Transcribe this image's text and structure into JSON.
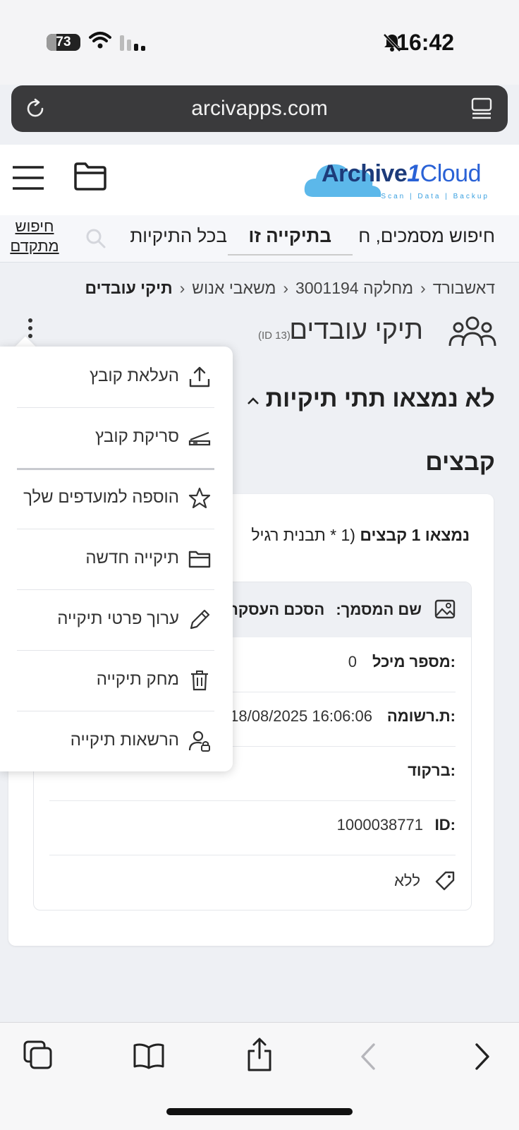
{
  "status": {
    "battery": "73",
    "time": "16:42"
  },
  "browser": {
    "url": "arcivapps.com"
  },
  "header": {
    "logo_main": "Archive",
    "logo_num": "1",
    "logo_cloud": "Cloud",
    "logo_sub": "Scan | Data | Backup"
  },
  "search": {
    "placeholder": "חיפוש מסמכים, ח",
    "tab_this_folder": "בתיקייה זו",
    "tab_all_folders": "בכל התיקיות",
    "advanced_line1": "חיפוש",
    "advanced_line2": "מתקדם"
  },
  "breadcrumb": {
    "items": [
      "דאשבורד",
      "מחלקה 3001194",
      "משאבי אנוש",
      "תיקי עובדים"
    ]
  },
  "page": {
    "title": "תיקי עובדים",
    "id_label": "(ID 13)"
  },
  "subfolders": {
    "heading": "לא נמצאו תתי תיקיות"
  },
  "files": {
    "heading": "קבצים",
    "found_bold": "נמצאו 1 קבצים",
    "found_rest": "(1 * תבנית רגיל",
    "doc_name_label": "שם המסמך:",
    "doc_name_value": "הסכם העסקה",
    "rows": [
      {
        "label": "מספר מיכל:",
        "value": "0"
      },
      {
        "label": "ת.רשומה:",
        "value": "18/08/2025 16:06:06"
      },
      {
        "label": "ברקוד:",
        "value": ""
      },
      {
        "label": "ID:",
        "value": "1000038771"
      }
    ],
    "tag": "ללא"
  },
  "menu": {
    "items": [
      {
        "label": "העלאת קובץ",
        "icon": "upload-icon"
      },
      {
        "label": "סריקת קובץ",
        "icon": "scanner-icon"
      },
      {
        "label": "הוספה למועדפים שלך",
        "icon": "star-icon"
      },
      {
        "label": "תיקייה חדשה",
        "icon": "folder-icon"
      },
      {
        "label": "ערוך פרטי תיקייה",
        "icon": "pencil-icon"
      },
      {
        "label": "מחק תיקייה",
        "icon": "trash-icon"
      },
      {
        "label": "הרשאות תיקייה",
        "icon": "user-lock-icon"
      }
    ]
  }
}
